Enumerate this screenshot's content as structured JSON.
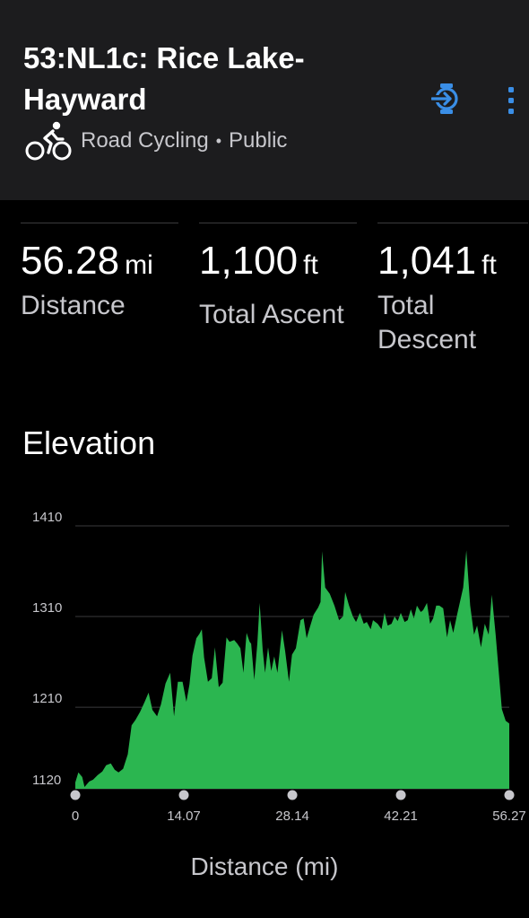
{
  "route": {
    "title": "53:NL1c: Rice Lake-Hayward",
    "activity_type": "Road Cycling",
    "separator": "•",
    "visibility": "Public"
  },
  "icons": {
    "activity": "bike-rider-icon",
    "send": "send-to-device-icon",
    "more": "more-vertical-icon"
  },
  "colors": {
    "header_bg": "#1c1c1e",
    "accent": "#3a8ee6",
    "elevation_fill": "#2bb650"
  },
  "stats": {
    "distance": {
      "value": "56.28",
      "unit": "mi",
      "label": "Distance"
    },
    "ascent": {
      "value": "1,100",
      "unit": "ft",
      "label": "Total Ascent"
    },
    "descent": {
      "value": "1,041",
      "unit": "ft",
      "label": "Total Descent"
    }
  },
  "elevation": {
    "title": "Elevation",
    "xlabel": "Distance (mi)"
  },
  "chart_data": {
    "type": "area",
    "title": "Elevation",
    "xlabel": "Distance (mi)",
    "ylabel": "",
    "ylim": [
      1120,
      1410
    ],
    "xlim": [
      0,
      56.27
    ],
    "y_ticks": [
      "1410",
      "1310",
      "1210",
      "1120"
    ],
    "x_ticks": [
      "0",
      "14.07",
      "28.14",
      "42.21",
      "56.27"
    ],
    "grid": true,
    "series": [
      {
        "values": [
          [
            0,
            1127
          ],
          [
            0.4,
            1138
          ],
          [
            0.9,
            1133
          ],
          [
            1.2,
            1122
          ],
          [
            1.8,
            1128
          ],
          [
            2.3,
            1130
          ],
          [
            2.9,
            1135
          ],
          [
            3.5,
            1139
          ],
          [
            4.0,
            1146
          ],
          [
            4.6,
            1148
          ],
          [
            5.1,
            1141
          ],
          [
            5.6,
            1138
          ],
          [
            6.2,
            1142
          ],
          [
            6.8,
            1158
          ],
          [
            7.3,
            1190
          ],
          [
            7.8,
            1196
          ],
          [
            8.4,
            1205
          ],
          [
            9.0,
            1216
          ],
          [
            9.5,
            1226
          ],
          [
            10.0,
            1207
          ],
          [
            10.6,
            1200
          ],
          [
            11.1,
            1213
          ],
          [
            11.7,
            1236
          ],
          [
            12.3,
            1248
          ],
          [
            12.8,
            1200
          ],
          [
            13.3,
            1238
          ],
          [
            13.9,
            1238
          ],
          [
            14.4,
            1216
          ],
          [
            14.8,
            1235
          ],
          [
            15.2,
            1267
          ],
          [
            15.7,
            1286
          ],
          [
            16.1,
            1291
          ],
          [
            16.4,
            1296
          ],
          [
            16.7,
            1265
          ],
          [
            17.2,
            1238
          ],
          [
            17.7,
            1242
          ],
          [
            18.1,
            1276
          ],
          [
            18.6,
            1232
          ],
          [
            19.1,
            1237
          ],
          [
            19.6,
            1287
          ],
          [
            20.0,
            1282
          ],
          [
            20.6,
            1284
          ],
          [
            21.0,
            1280
          ],
          [
            21.4,
            1275
          ],
          [
            21.8,
            1248
          ],
          [
            22.2,
            1292
          ],
          [
            22.6,
            1282
          ],
          [
            22.8,
            1280
          ],
          [
            23.2,
            1240
          ],
          [
            23.6,
            1280
          ],
          [
            23.9,
            1325
          ],
          [
            24.3,
            1273
          ],
          [
            24.6,
            1248
          ],
          [
            25.0,
            1276
          ],
          [
            25.4,
            1250
          ],
          [
            25.8,
            1266
          ],
          [
            26.2,
            1248
          ],
          [
            26.8,
            1295
          ],
          [
            27.2,
            1272
          ],
          [
            27.7,
            1238
          ],
          [
            28.1,
            1268
          ],
          [
            28.6,
            1275
          ],
          [
            29.2,
            1306
          ],
          [
            29.6,
            1308
          ],
          [
            30.0,
            1286
          ],
          [
            30.4,
            1298
          ],
          [
            30.9,
            1312
          ],
          [
            31.5,
            1320
          ],
          [
            31.8,
            1326
          ],
          [
            32.0,
            1382
          ],
          [
            32.4,
            1342
          ],
          [
            33.0,
            1335
          ],
          [
            33.6,
            1322
          ],
          [
            34.2,
            1306
          ],
          [
            34.7,
            1310
          ],
          [
            35.0,
            1337
          ],
          [
            35.5,
            1322
          ],
          [
            36.0,
            1310
          ],
          [
            36.4,
            1304
          ],
          [
            36.9,
            1314
          ],
          [
            37.4,
            1302
          ],
          [
            37.8,
            1304
          ],
          [
            38.3,
            1296
          ],
          [
            38.6,
            1306
          ],
          [
            39.2,
            1302
          ],
          [
            39.7,
            1296
          ],
          [
            40.1,
            1314
          ],
          [
            40.5,
            1300
          ],
          [
            41.0,
            1302
          ],
          [
            41.4,
            1310
          ],
          [
            41.8,
            1305
          ],
          [
            42.2,
            1314
          ],
          [
            42.7,
            1304
          ],
          [
            43.1,
            1306
          ],
          [
            43.5,
            1318
          ],
          [
            43.9,
            1308
          ],
          [
            44.3,
            1322
          ],
          [
            44.8,
            1315
          ],
          [
            45.1,
            1317
          ],
          [
            45.6,
            1325
          ],
          [
            46.0,
            1302
          ],
          [
            46.4,
            1308
          ],
          [
            46.8,
            1322
          ],
          [
            47.2,
            1322
          ],
          [
            47.7,
            1319
          ],
          [
            48.2,
            1287
          ],
          [
            48.6,
            1306
          ],
          [
            49.0,
            1292
          ],
          [
            49.5,
            1312
          ],
          [
            50.3,
            1342
          ],
          [
            50.7,
            1383
          ],
          [
            51.2,
            1322
          ],
          [
            51.7,
            1290
          ],
          [
            52.1,
            1300
          ],
          [
            52.6,
            1276
          ],
          [
            53.1,
            1302
          ],
          [
            53.6,
            1290
          ],
          [
            54.0,
            1334
          ],
          [
            54.5,
            1290
          ],
          [
            54.9,
            1250
          ],
          [
            55.3,
            1208
          ],
          [
            55.8,
            1195
          ],
          [
            56.27,
            1192
          ]
        ]
      }
    ]
  }
}
